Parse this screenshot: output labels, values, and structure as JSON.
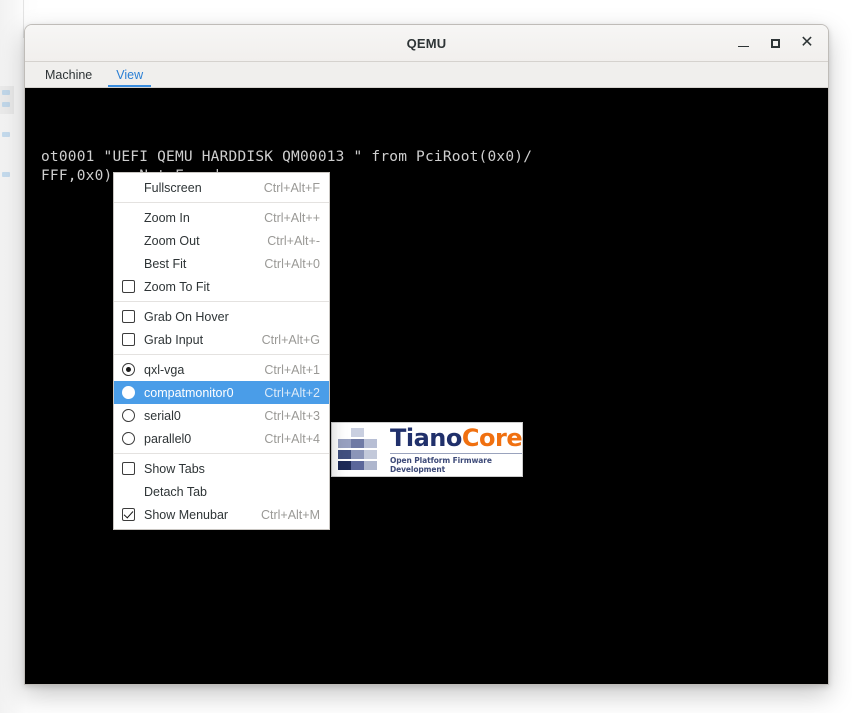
{
  "window": {
    "title": "QEMU",
    "controls": [
      {
        "name": "minimize-button",
        "icon": "minimize-icon",
        "label": "–"
      },
      {
        "name": "maximize-button",
        "icon": "maximize-icon",
        "label": "□"
      },
      {
        "name": "close-button",
        "icon": "close-icon",
        "label": "×"
      }
    ]
  },
  "menubar": {
    "items": [
      {
        "label": "Machine",
        "active": false
      },
      {
        "label": "View",
        "active": true
      }
    ]
  },
  "view_menu": {
    "items": [
      {
        "type": "action",
        "label": "Fullscreen",
        "accel": "Ctrl+Alt+F",
        "mark": "none",
        "selected": false
      },
      {
        "type": "separator"
      },
      {
        "type": "action",
        "label": "Zoom In",
        "accel": "Ctrl+Alt++",
        "mark": "none",
        "selected": false
      },
      {
        "type": "action",
        "label": "Zoom Out",
        "accel": "Ctrl+Alt+-",
        "mark": "none",
        "selected": false
      },
      {
        "type": "action",
        "label": "Best Fit",
        "accel": "Ctrl+Alt+0",
        "mark": "none",
        "selected": false
      },
      {
        "type": "check",
        "label": "Zoom To Fit",
        "accel": "",
        "mark": "checkbox-unchecked",
        "selected": false
      },
      {
        "type": "separator"
      },
      {
        "type": "check",
        "label": "Grab On Hover",
        "accel": "",
        "mark": "checkbox-unchecked",
        "selected": false
      },
      {
        "type": "check",
        "label": "Grab Input",
        "accel": "Ctrl+Alt+G",
        "mark": "checkbox-unchecked",
        "selected": false
      },
      {
        "type": "separator"
      },
      {
        "type": "radio",
        "label": "qxl-vga",
        "accel": "Ctrl+Alt+1",
        "mark": "radio-on",
        "selected": false
      },
      {
        "type": "radio",
        "label": "compatmonitor0",
        "accel": "Ctrl+Alt+2",
        "mark": "radio-off",
        "selected": true
      },
      {
        "type": "radio",
        "label": "serial0",
        "accel": "Ctrl+Alt+3",
        "mark": "radio-off",
        "selected": false
      },
      {
        "type": "radio",
        "label": "parallel0",
        "accel": "Ctrl+Alt+4",
        "mark": "radio-off",
        "selected": false
      },
      {
        "type": "separator"
      },
      {
        "type": "check",
        "label": "Show Tabs",
        "accel": "",
        "mark": "checkbox-unchecked",
        "selected": false
      },
      {
        "type": "action",
        "label": "Detach Tab",
        "accel": "",
        "mark": "none",
        "selected": false
      },
      {
        "type": "check",
        "label": "Show Menubar",
        "accel": "Ctrl+Alt+M",
        "mark": "checkbox-checked",
        "selected": false
      }
    ]
  },
  "vm": {
    "console_text": "ot0001 \"UEFI QEMU HARDDISK QM00013 \" from PciRoot(0x0)/\nFFF,0x0) : Not Found",
    "logo": {
      "word_part1": "Tiano",
      "word_part2": "Core",
      "tagline": "Open Platform Firmware Development"
    }
  },
  "colors": {
    "menu_highlight": "#4a9de8",
    "menubar_active": "#2a7fd4",
    "accel_text": "#9a9996",
    "vm_background": "#000000",
    "console_text": "#cfcfcf",
    "logo_navy": "#20306b",
    "logo_orange": "#f07010"
  }
}
